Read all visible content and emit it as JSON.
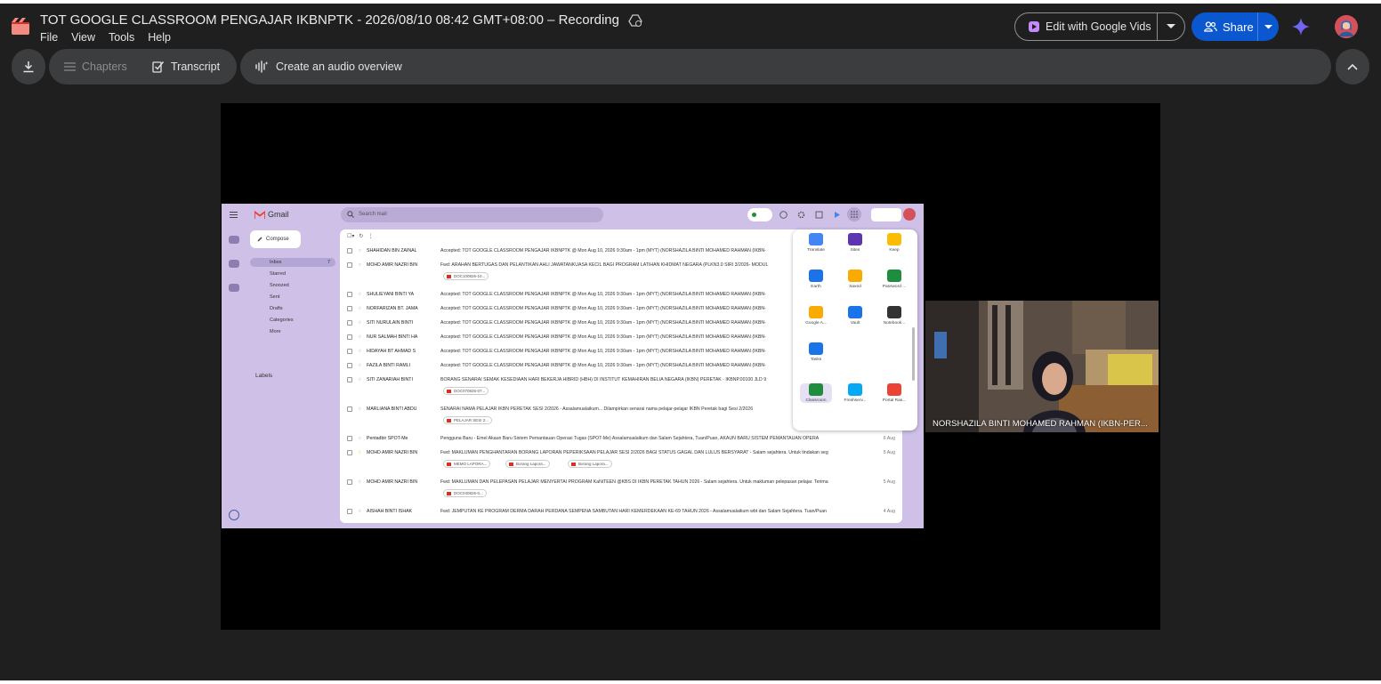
{
  "header": {
    "doc_title": "TOT GOOGLE CLASSROOM PENGAJAR IKBNPTK - 2026/08/10 08:42 GMT+08:00 – Recording",
    "menu": [
      "File",
      "View",
      "Tools",
      "Help"
    ],
    "edit_vids_label": "Edit with Google Vids",
    "share_label": "Share"
  },
  "toolbar": {
    "chapters_label": "Chapters",
    "transcript_label": "Transcript",
    "audio_overview_label": "Create an audio overview"
  },
  "colors": {
    "share_blue": "#0b57d0",
    "app_bg": "#1f1f1f",
    "pill_bg": "#3c3d3f",
    "gmail_bg": "#cec0e6"
  },
  "video": {
    "participant_name": "NORSHAZILA BINTI MOHAMED RAHMAN (IKBN-PER...",
    "gmail": {
      "app_name": "Gmail",
      "search_placeholder": "Search mail",
      "compose": "Compose",
      "nav": [
        "Inbox",
        "Starred",
        "Snoozed",
        "Sent",
        "Drafts",
        "Categories",
        "More"
      ],
      "inbox_count": "7",
      "labels_heading": "Labels",
      "rows": [
        {
          "sender": "SHAHIDAN BIN ZAINAL",
          "subject": "Accepted: TOT GOOGLE CLASSROOM PENGAJAR IKBNPTK @ Mon Aug 10, 2026 9:30am - 1pm (MYT) (NORSHAZILA BINTI MOHAMED RAHMAN (IKBN-",
          "date": ""
        },
        {
          "sender": "MOHD AMIR NAZRI BIN",
          "subject": "Fwd: ARAHAN BERTUGAS DAN PELANTIKAN AHLI JAWATANKUASA KECIL BAGI PROGRAM LATIHAN KHIDMAT NEGARA (PLKN3.0 SIRI 3/2026- MODUL",
          "date": "",
          "chips": [
            "DOC100826-10..."
          ]
        },
        {
          "sender": "SHULIEYANI BINTI YA",
          "subject": "Accepted: TOT GOOGLE CLASSROOM PENGAJAR IKBNPTK @ Mon Aug 10, 2026 9:30am - 1pm (MYT) (NORSHAZILA BINTI MOHAMED RAHMAN (IKBN-",
          "date": ""
        },
        {
          "sender": "NORFARIZAN BT. JAMA",
          "subject": "Accepted: TOT GOOGLE CLASSROOM PENGAJAR IKBNPTK @ Mon Aug 10, 2026 9:30am - 1pm (MYT) (NORSHAZILA BINTI MOHAMED RAHMAN (IKBN-",
          "date": ""
        },
        {
          "sender": "SITI NURULAIN BINTI",
          "subject": "Accepted: TOT GOOGLE CLASSROOM PENGAJAR IKBNPTK @ Mon Aug 10, 2026 9:30am - 1pm (MYT) (NORSHAZILA BINTI MOHAMED RAHMAN (IKBN-",
          "date": ""
        },
        {
          "sender": "NUR SALMAH BINTI HA",
          "subject": "Accepted: TOT GOOGLE CLASSROOM PENGAJAR IKBNPTK @ Mon Aug 10, 2026 9:30am - 1pm (MYT) (NORSHAZILA BINTI MOHAMED RAHMAN (IKBN-",
          "date": ""
        },
        {
          "sender": "HIDAYAH BT AHMAD S",
          "subject": "Accepted: TOT GOOGLE CLASSROOM PENGAJAR IKBNPTK @ Mon Aug 10, 2026 9:30am - 1pm (MYT) (NORSHAZILA BINTI MOHAMED RAHMAN (IKBN-",
          "date": ""
        },
        {
          "sender": "FAZILA BINTI RAMLI",
          "subject": "Accepted: TOT GOOGLE CLASSROOM PENGAJAR IKBNPTK @ Mon Aug 10, 2026 9:30am - 1pm (MYT) (NORSHAZILA BINTI MOHAMED RAHMAN (IKBN-",
          "date": ""
        },
        {
          "sender": "SITI ZANARIAH BINTI",
          "subject": "BORANG SENARAI SEMAK KESEDIAAN HARI BEKERJA HIBRID (HBH) DI INSTITUT KEMAHIRAN BELIA NEGARA (IKBN) PERETAK - IKBNP.00100 JLD 9",
          "date": "",
          "chips": [
            "DOC070826-07..."
          ]
        },
        {
          "sender": "MARLIANA BINTI ABDU",
          "subject": "SENARAI NAMA PELAJAR IKBN PERETAK SESI 2/2026 - Assalamualaikum... Dilampirkan senarai nama pelajar-pelajar IKBN Peretak bagi Sesi 2/2026",
          "date": "",
          "chips": [
            "PELAJAR SESI 2..."
          ]
        },
        {
          "sender": "Pentadbir SPOT-Me",
          "subject": "Pengguna Baru - Emel Akaun Baru Sistem Pemantauan Operasi Tugas (SPOT-Me) Assalamualaikum dan Salam Sejahtera, Tuan/Puan, AKAUN BARU SISTEM PEMANTAUAN OPERA",
          "date": "6 Aug"
        },
        {
          "sender": "MOHD AMIR NAZRI BIN",
          "subject": "Fwd: MAKLUMAN PENGHANTARAN BORANG LAPORAN PEPERIKSAAN PELAJAR SESI 2/2026 BAGI STATUS GAGAL DAN LULUS BERSYARAT - Salam sejahtera. Untuk tindakan seg",
          "date": "5 Aug",
          "chips": [
            "MEMO LAPORA...",
            "Borang Lapora...",
            "Borang Lapora..."
          ]
        },
        {
          "sender": "MOHD AMIR NAZRI BIN",
          "subject": "Fwd: MAKLUMAN DAN PELEPASAN PELAJAR MENYERTAI PROGRAM KaNiTEEN @KBS DI IKBN PERETAK TAHUN 2026 - Salam sejahtera. Untuk makluman pelepasan pelajar. Terima",
          "date": "5 Aug",
          "chips": [
            "DOC040826-0..."
          ]
        },
        {
          "sender": "AISHAH BINTI ISHAK",
          "subject": "Fwd: JEMPUTAN KE PROGRAM DERMA DARAH PERDANA SEMPENA SAMBUTAN HARI KEMERDEKAAN KE-69 TAHUN 2026 - Assalamualaikum wbt dan Salam Sejahtera. Tuan/Puan",
          "date": "4 Aug"
        }
      ],
      "apps": [
        {
          "name": "Translate",
          "icon": "translate-icon",
          "color": "#4285f4"
        },
        {
          "name": "Sites",
          "icon": "sites-icon",
          "color": "#5e35b1"
        },
        {
          "name": "Keep",
          "icon": "keep-icon",
          "color": "#fbbc04"
        },
        {
          "name": "Earth",
          "icon": "earth-icon",
          "color": "#1a73e8"
        },
        {
          "name": "Saved",
          "icon": "saved-icon",
          "color": "#f9ab00"
        },
        {
          "name": "Password ...",
          "icon": "password-icon",
          "color": "#1e8e3e"
        },
        {
          "name": "Google A...",
          "icon": "analytics-icon",
          "color": "#f9ab00"
        },
        {
          "name": "Vault",
          "icon": "vault-icon",
          "color": "#1a73e8"
        },
        {
          "name": "Notebook...",
          "icon": "notebooklm-icon",
          "color": "#333333"
        },
        {
          "name": "Tasks",
          "icon": "tasks-icon",
          "color": "#1a73e8"
        },
        {
          "name": "Classroom",
          "icon": "classroom-icon",
          "color": "#1e8e3e"
        },
        {
          "name": "Freshserv...",
          "icon": "freshservice-icon",
          "color": "#03a9f4"
        },
        {
          "name": "Portal Ras...",
          "icon": "portal-icon",
          "color": "#ea4335"
        }
      ]
    }
  }
}
